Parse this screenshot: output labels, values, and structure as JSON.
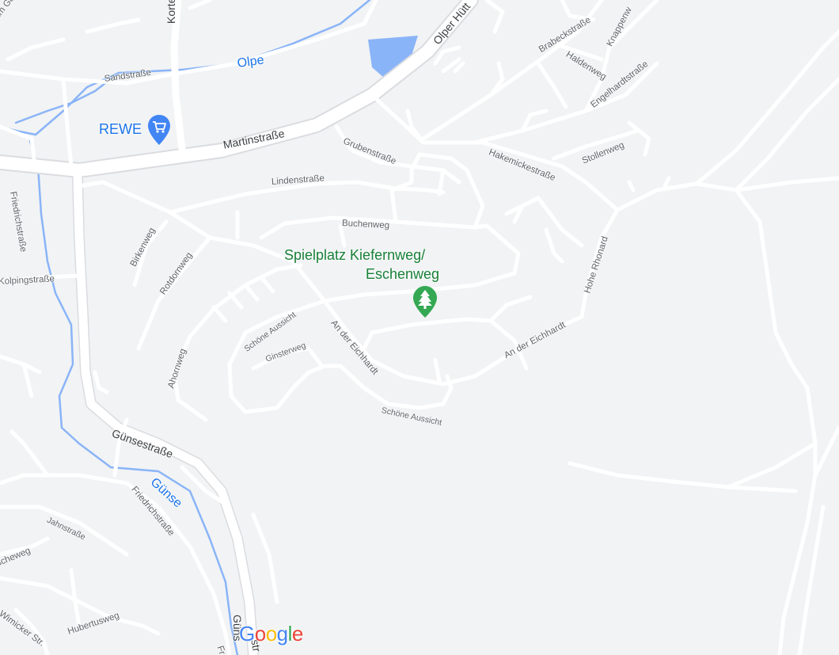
{
  "map": {
    "colors": {
      "background": "#f1f3f4",
      "road": "#ffffff",
      "road_outline": "#dadce0",
      "water": "#8ab4f8",
      "water_label": "#1a73e8",
      "park_pin": "#34a853",
      "shop_pin": "#4285f4"
    },
    "streets": {
      "am_galle": "Am Galle",
      "kortem": "Kortem",
      "sandstrasse": "Sandstraße",
      "martinstrasse": "Martinstraße",
      "olper_huett": "Olper Hütt",
      "brabeckstrasse": "Brabeckstraße",
      "knappenweg": "Knappenw",
      "haldenweg": "Haldenweg",
      "engelhardtstrasse": "Engelhardtstraße",
      "grubenstrasse": "Grubenstraße",
      "hakemickestrasse": "Hakemickestraße",
      "stollenweg": "Stollenweg",
      "lindenstrasse": "Lindenstraße",
      "friedrichstrasse_top": "Friedrichstraße",
      "buchenweg": "Buchenweg",
      "birkenweg": "Birkenweg",
      "rotdornweg": "Rotdornweg",
      "kolpingstrasse": "Kolpingstraße",
      "hohe_rhonard": "Hohe Rhonard",
      "schoene_aussicht_1": "Schöne Aussicht",
      "an_der_eichhardt_1": "An der Eichhardt",
      "an_der_eichhardt_2": "An der Eichhardt",
      "ginsterweg": "Ginsterweg",
      "ahornweg": "Ahornweg",
      "schoene_aussicht_2": "Schöne Aussicht",
      "guensestrasse": "Günsestraße",
      "friedrichstrasse_bottom": "Friedrichstraße",
      "jahnstrasse": "Jahnstraße",
      "escheweg": "scheweg",
      "hubertusweg": "Hubertusweg",
      "wimicker": "Wimicker Str.",
      "guens_bottom": "Güns",
      "str_bottom": "str",
      "fr_bottom": "Fr"
    },
    "water_labels": {
      "olpe": "Olpe",
      "guense": "Günse"
    },
    "pois": {
      "rewe": {
        "label": "REWE",
        "icon": "shopping-cart-icon"
      },
      "playground": {
        "label_line1": "Spielplatz Kiefernweg/",
        "label_line2": "Eschenweg",
        "icon": "tree-icon"
      }
    },
    "logo": {
      "text": "Google",
      "letters": [
        "G",
        "o",
        "o",
        "g",
        "l",
        "e"
      ]
    }
  }
}
